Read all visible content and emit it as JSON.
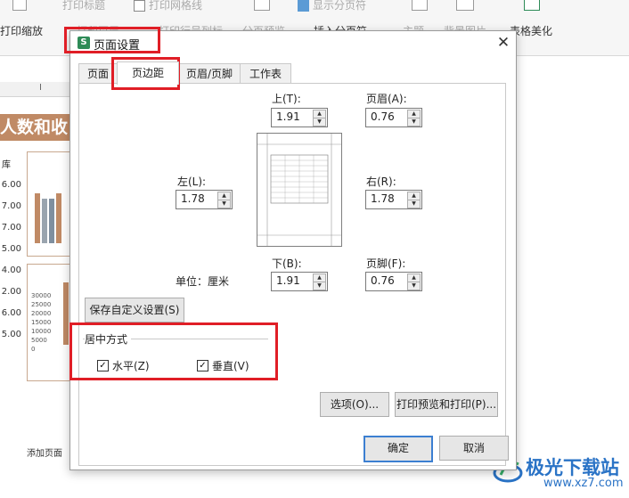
{
  "ribbon": {
    "items": [
      "打印标题",
      "打印网格线",
      "显示分页符",
      "打印缩放",
      "打印页眉",
      "打印行号列标",
      "分页预览",
      "插入分页符",
      "主题",
      "背景图片",
      "表格美化"
    ]
  },
  "sheet": {
    "title": "人数和收",
    "col_header_marker": "I",
    "side_values": [
      "6.00",
      "7.00",
      "7.00",
      "5.00",
      "4.00",
      "2.00",
      "6.00",
      "5.00"
    ],
    "row_header_label": "库",
    "chart2_ticks": [
      "30000",
      "25000",
      "20000",
      "15000",
      "10000",
      "5000",
      "0"
    ],
    "add_page": "添加页面"
  },
  "watermark": {
    "brand": "极光下载站",
    "url": "www.xz7.com"
  },
  "dialog": {
    "app_icon": "S",
    "title": "页面设置",
    "tabs": [
      "页面",
      "页边距",
      "页眉/页脚",
      "工作表"
    ],
    "active_tab": "页边距",
    "margins": {
      "top_label": "上(T):",
      "top_value": "1.91",
      "header_label": "页眉(A):",
      "header_value": "0.76",
      "left_label": "左(L):",
      "left_value": "1.78",
      "right_label": "右(R):",
      "right_value": "1.78",
      "bottom_label": "下(B):",
      "bottom_value": "1.91",
      "footer_label": "页脚(F):",
      "footer_value": "0.76"
    },
    "unit_label": "单位：厘米",
    "save_custom_button": "保存自定义设置(S)",
    "center_group_label": "居中方式",
    "horizontal_label": "水平(Z)",
    "horizontal_checked": true,
    "vertical_label": "垂直(V)",
    "vertical_checked": true,
    "options_button": "选项(O)...",
    "print_preview_button": "打印预览和打印(P)...",
    "ok_button": "确定",
    "cancel_button": "取消"
  },
  "colors": {
    "accent": "#e01e26",
    "primary_border": "#3c7fd1",
    "title_fill": "#c08a65"
  }
}
